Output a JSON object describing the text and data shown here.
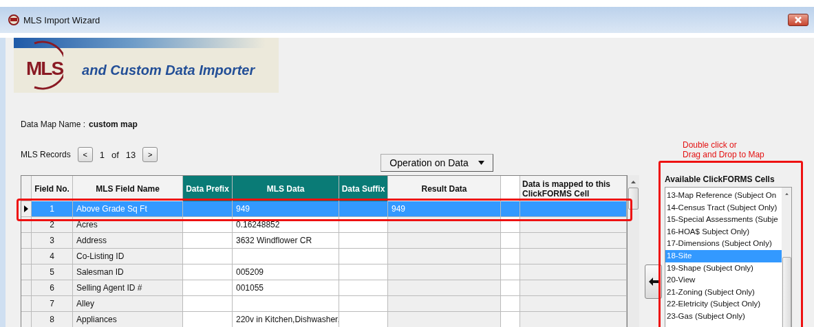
{
  "window": {
    "title": "MLS Import Wizard"
  },
  "banner": {
    "logo": "MLS",
    "subtitle": "and Custom Data Importer"
  },
  "data_map": {
    "label": "Data Map Name :",
    "value": "custom map"
  },
  "records": {
    "label": "MLS Records",
    "current": "1",
    "of": "of",
    "total": "13",
    "prev": "<",
    "next": ">"
  },
  "operation_button": {
    "label": "Operation on Data"
  },
  "table": {
    "columns": [
      {
        "kind": "plain",
        "label": "Field No."
      },
      {
        "kind": "plain",
        "label": "MLS Field Name"
      },
      {
        "kind": "teal",
        "label": "Data Prefix"
      },
      {
        "kind": "teal",
        "label": "MLS Data"
      },
      {
        "kind": "teal",
        "label": "Data Suffix"
      },
      {
        "kind": "plain",
        "label": "Result Data"
      },
      {
        "kind": "blank"
      },
      {
        "kind": "note",
        "label": "Data is mapped to this ClickFORMS Cell"
      }
    ],
    "rows": [
      {
        "selected": true,
        "field_no": "1",
        "name": "Above Grade Sq Ft",
        "mls_data": "949",
        "result_data": "949"
      },
      {
        "selected": false,
        "field_no": "2",
        "name": "Acres",
        "mls_data": "0.16248852"
      },
      {
        "selected": false,
        "field_no": "3",
        "name": "Address",
        "mls_data": "3632 Windflower CR"
      },
      {
        "selected": false,
        "field_no": "4",
        "name": "Co-Listing ID"
      },
      {
        "selected": false,
        "field_no": "5",
        "name": "Salesman ID",
        "mls_data": "005209"
      },
      {
        "selected": false,
        "field_no": "6",
        "name": "Selling Agent ID #",
        "mls_data": "001055"
      },
      {
        "selected": false,
        "field_no": "7",
        "name": "Alley"
      },
      {
        "selected": false,
        "field_no": "8",
        "name": "Appliances",
        "mls_data": "220v in Kitchen,Dishwasher,"
      }
    ]
  },
  "cells_panel": {
    "hint_lines": [
      "Double click or",
      "Drag and Drop to Map"
    ],
    "title": "Available ClickFORMS Cells",
    "items": [
      {
        "label": "13-Map Reference (Subject On",
        "selected": false
      },
      {
        "label": "14-Census Tract (Subject Only)",
        "selected": false
      },
      {
        "label": "15-Special Assessments (Subje",
        "selected": false
      },
      {
        "label": "16-HOA$ Subject Only)",
        "selected": false
      },
      {
        "label": "17-Dimensions (Subject Only)",
        "selected": false
      },
      {
        "label": "18-Site",
        "selected": true
      },
      {
        "label": "19-Shape (Subject Only)",
        "selected": false
      },
      {
        "label": "20-View",
        "selected": false
      },
      {
        "label": "21-Zoning (Subject Only)",
        "selected": false
      },
      {
        "label": "22-Eletricity (Subject Only)",
        "selected": false
      },
      {
        "label": "23-Gas (Subject Only)",
        "selected": false
      }
    ]
  }
}
